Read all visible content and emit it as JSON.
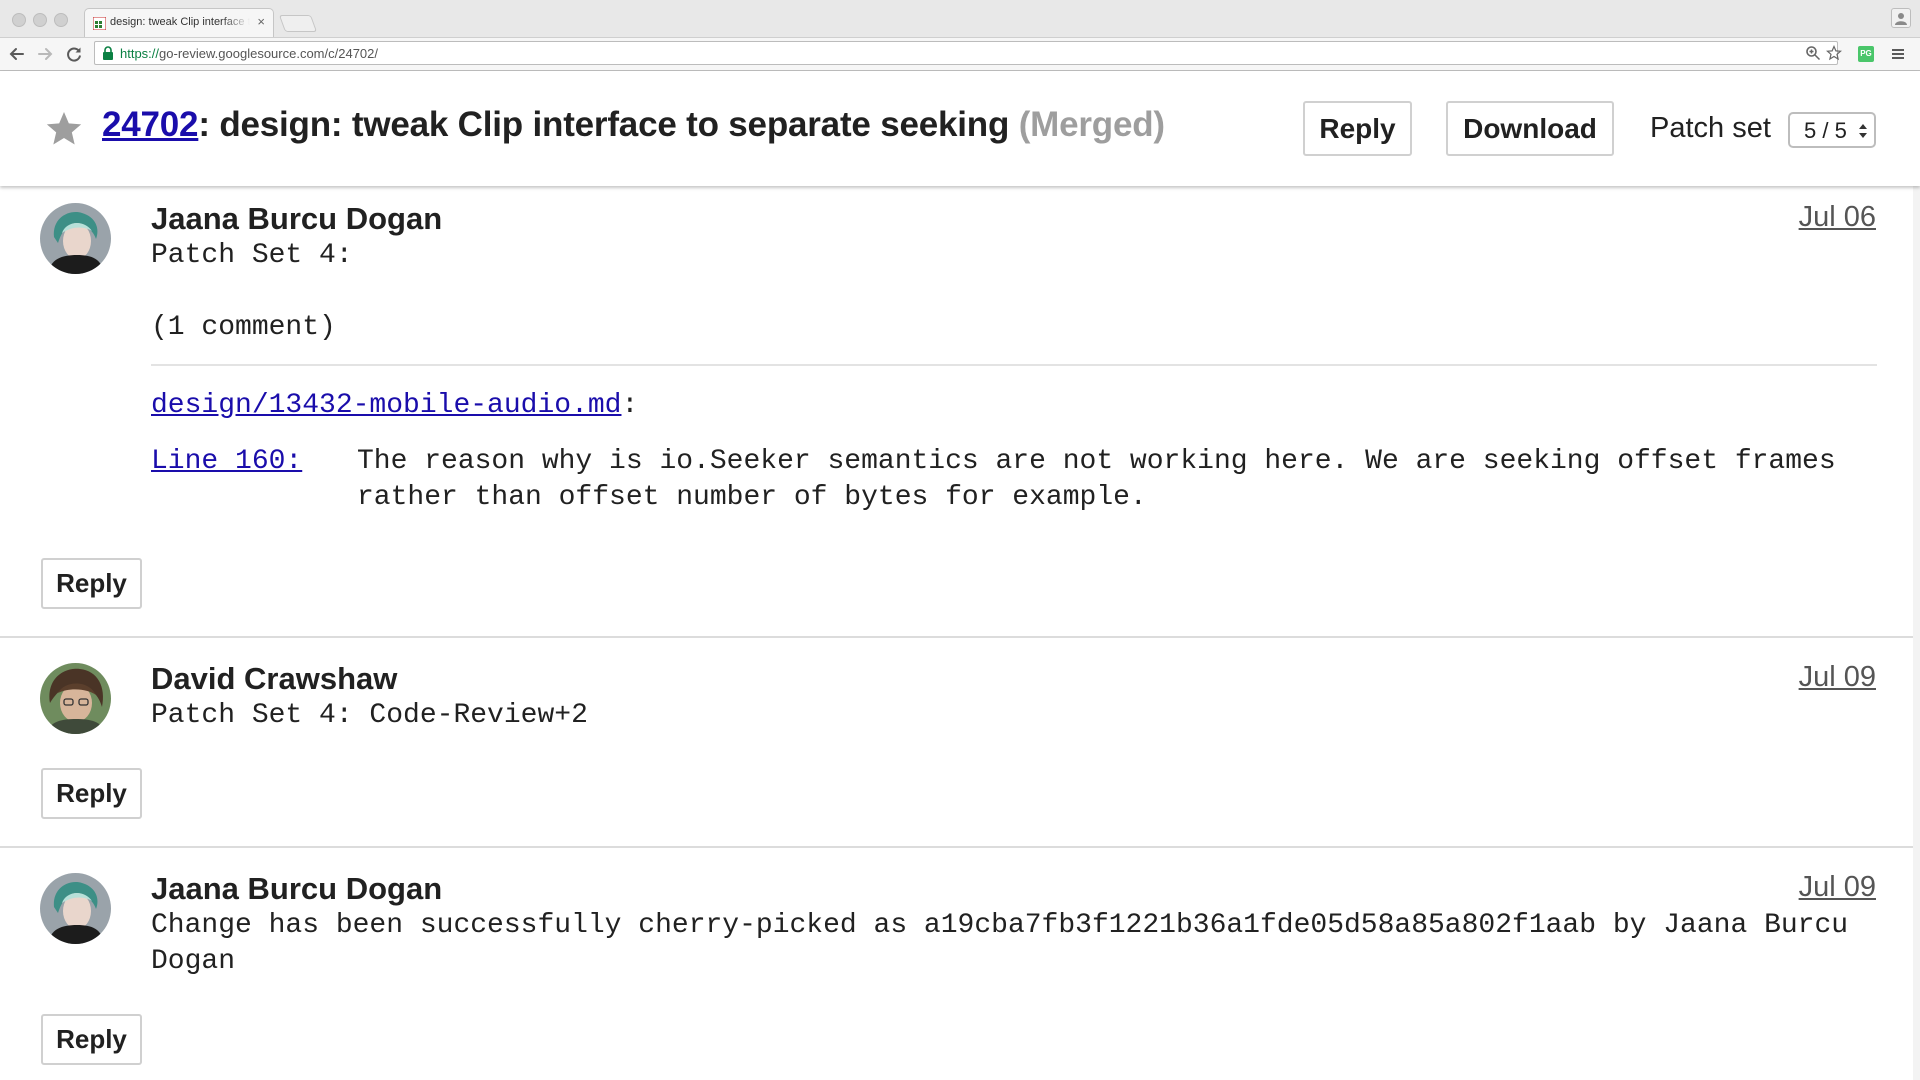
{
  "browser": {
    "tab_title": "design: tweak Clip interface to separate seeking",
    "tab_close": "×",
    "url_scheme": "https://",
    "url_rest": "go-review.googlesource.com/c/24702/",
    "extension_label": "PG"
  },
  "header": {
    "change_number": "24702",
    "title_sep": ": ",
    "title": "design: tweak Clip interface to separate seeking",
    "status": "(Merged)",
    "reply_label": "Reply",
    "download_label": "Download",
    "patchset_label": "Patch set",
    "patchset_value": "5 / 5"
  },
  "messages": [
    {
      "author": "Jaana Burcu Dogan",
      "date": "Jul 06",
      "heading": "Patch Set 4:",
      "comment_count": "(1 comment)",
      "file": "design/13432-mobile-audio.md",
      "file_suffix": ":",
      "line_ref": "Line 160:",
      "comment_line1": "The reason why is io.Seeker semantics are not working here. We are seeking offset frames",
      "comment_line2": "rather than offset number of bytes for example.",
      "reply_label": "Reply"
    },
    {
      "author": "David Crawshaw",
      "date": "Jul 09",
      "heading": "Patch Set 4: Code-Review+2",
      "reply_label": "Reply"
    },
    {
      "author": "Jaana Burcu Dogan",
      "date": "Jul 09",
      "text_line1": "Change has been successfully cherry-picked as a19cba7fb3f1221b36a1fde05d58a85a802f1aab by Jaana Burcu",
      "text_line2": "Dogan",
      "reply_label": "Reply"
    }
  ]
}
